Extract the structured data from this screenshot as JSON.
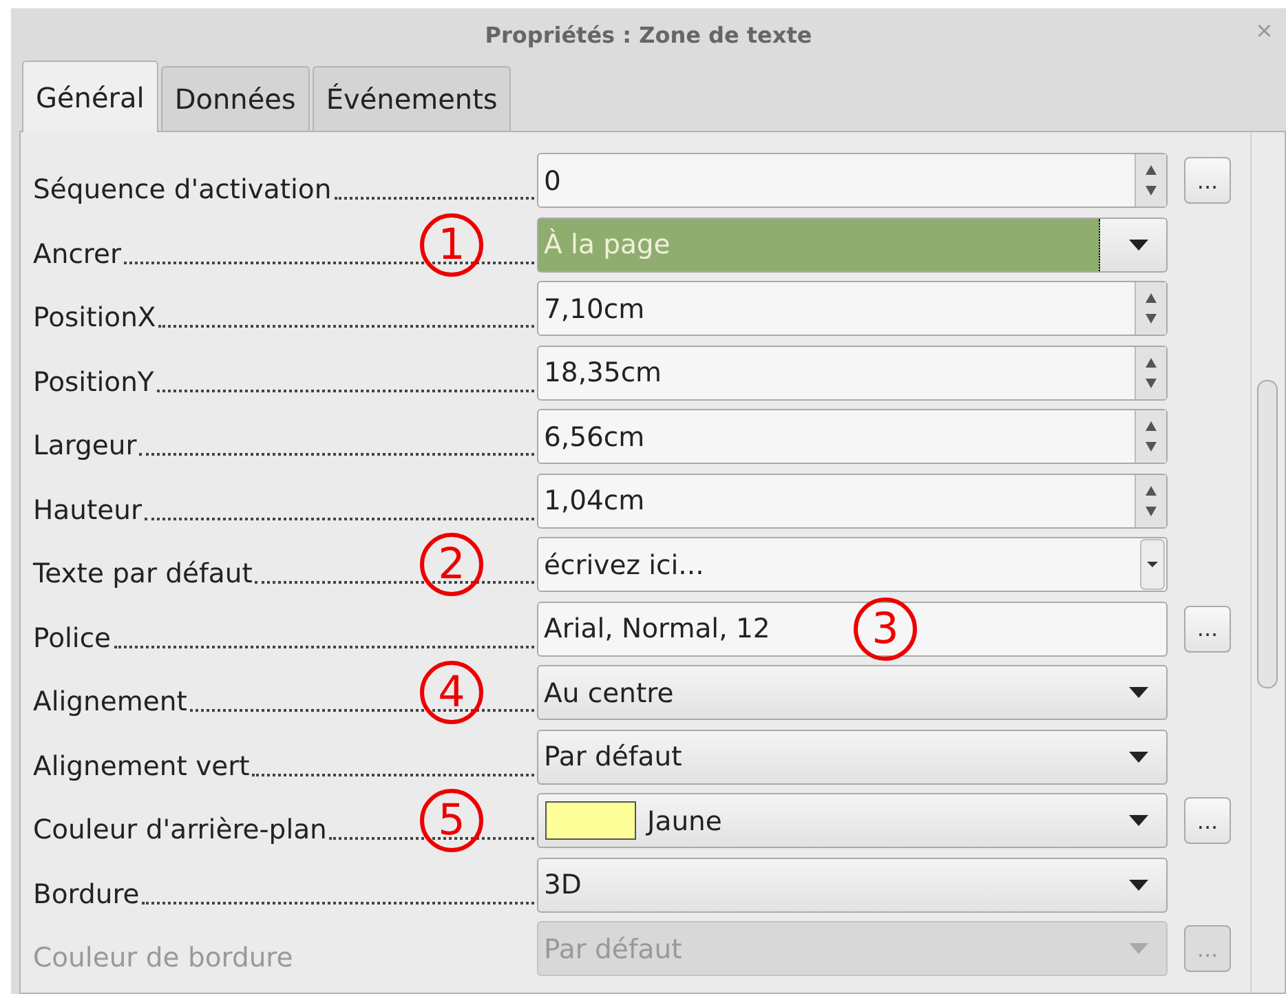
{
  "window": {
    "title": "Propriétés : Zone de texte",
    "close": "×"
  },
  "tabs": [
    {
      "label": "Général",
      "selected": true
    },
    {
      "label": "Données",
      "selected": false
    },
    {
      "label": "Événements",
      "selected": false
    }
  ],
  "rows": [
    {
      "label": "Séquence d'activation",
      "kind": "spin",
      "value": "0",
      "button": "...",
      "disabled": false
    },
    {
      "label": "Ancrer",
      "kind": "dropdown",
      "value": "À la page",
      "highlighted": true,
      "disabled": false,
      "label_marker": "1"
    },
    {
      "label": "PositionX",
      "kind": "spin",
      "value": "7,10cm",
      "disabled": false
    },
    {
      "label": "PositionY",
      "kind": "spin",
      "value": "18,35cm",
      "disabled": false
    },
    {
      "label": "Largeur",
      "kind": "spin",
      "value": "6,56cm",
      "disabled": false
    },
    {
      "label": "Hauteur",
      "kind": "spin",
      "value": "1,04cm",
      "disabled": false
    },
    {
      "label": "Texte par défaut",
      "kind": "combo",
      "value": "écrivez ici...",
      "disabled": false,
      "label_marker": "2"
    },
    {
      "label": "Police",
      "kind": "text",
      "value": "Arial, Normal, 12",
      "button": "...",
      "disabled": false,
      "field_marker": "3"
    },
    {
      "label": "Alignement",
      "kind": "dropdown",
      "value": "Au centre",
      "highlighted": false,
      "disabled": false,
      "label_marker": "4"
    },
    {
      "label": "Alignement vert",
      "kind": "dropdown",
      "value": "Par défaut",
      "highlighted": false,
      "disabled": false
    },
    {
      "label": "Couleur d'arrière-plan",
      "kind": "dropdown",
      "value": "Jaune",
      "color": "#ffff99",
      "button": "...",
      "highlighted": false,
      "disabled": false,
      "label_marker": "5"
    },
    {
      "label": "Bordure",
      "kind": "dropdown",
      "value": "3D",
      "highlighted": false,
      "disabled": false
    },
    {
      "label": "Couleur de bordure",
      "kind": "dropdown",
      "value": "Par défaut",
      "button": "...",
      "highlighted": false,
      "disabled": true
    }
  ]
}
